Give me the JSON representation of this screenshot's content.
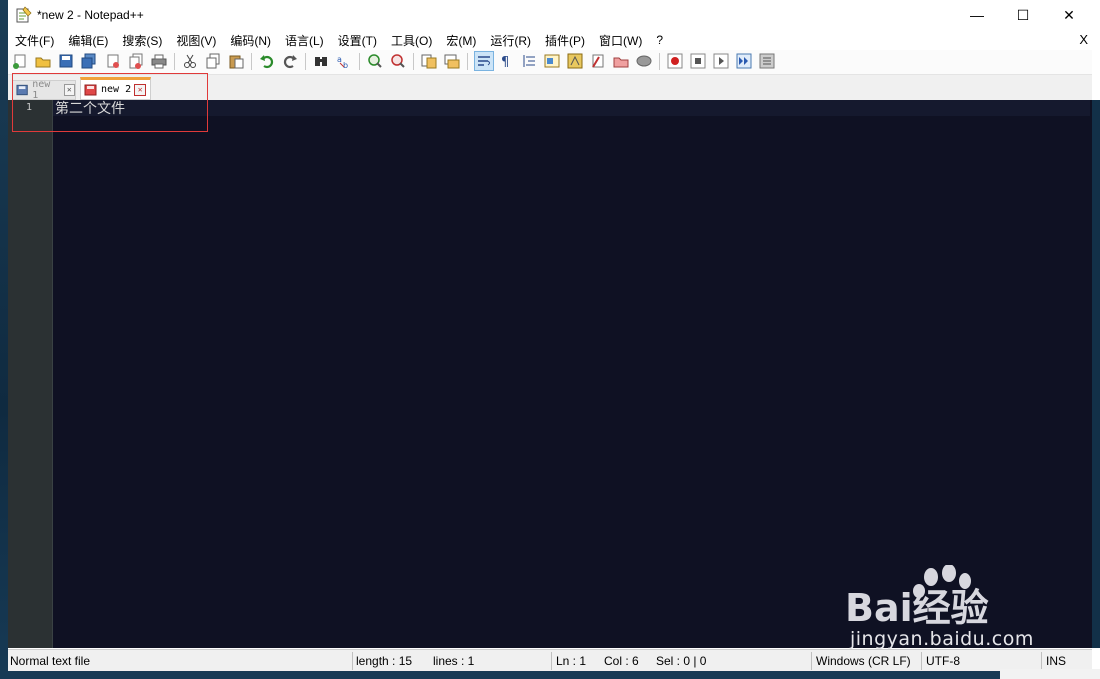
{
  "window": {
    "title": "*new 2 - Notepad++",
    "minimize_glyph": "—",
    "maximize_glyph": "☐",
    "close_glyph": "✕"
  },
  "menu": {
    "items": [
      "文件(F)",
      "编辑(E)",
      "搜索(S)",
      "视图(V)",
      "编码(N)",
      "语言(L)",
      "设置(T)",
      "工具(O)",
      "宏(M)",
      "运行(R)",
      "插件(P)",
      "窗口(W)",
      "?"
    ],
    "close_glyph": "X"
  },
  "toolbar": {
    "icons": [
      "new-file-icon",
      "open-file-icon",
      "save-icon",
      "save-all-icon",
      "close-icon",
      "close-all-icon",
      "print-icon",
      "cut-icon",
      "copy-icon",
      "paste-icon",
      "undo-icon",
      "redo-icon",
      "find-icon",
      "replace-icon",
      "zoom-in-icon",
      "zoom-out-icon",
      "sync-vertical-icon",
      "sync-horizontal-icon",
      "word-wrap-icon",
      "show-all-chars-icon",
      "indent-guide-icon",
      "doc-map-icon",
      "function-list-icon",
      "folder-as-workspace-icon",
      "monitoring-icon",
      "record-macro-icon",
      "stop-macro-icon",
      "play-macro-icon",
      "run-macro-multiple-icon",
      "save-macro-icon"
    ],
    "active_icon": "word-wrap-icon"
  },
  "tabs": [
    {
      "label": "new 1",
      "close_glyph": "✕",
      "active": false
    },
    {
      "label": "new 2",
      "close_glyph": "✕",
      "active": true
    }
  ],
  "editor": {
    "line_number": "1",
    "line_text": "第二个文件"
  },
  "status": {
    "file_type": "Normal text file",
    "length": "length : 15",
    "lines": "lines : 1",
    "ln": "Ln : 1",
    "col": "Col : 6",
    "sel": "Sel : 0 | 0",
    "eol": "Windows (CR LF)",
    "encoding": "UTF-8",
    "mode": "INS"
  },
  "watermark": {
    "brand_text": "Bai经验",
    "url": "jingyan.baidu.com"
  },
  "colors": {
    "editor_bg": "#0f1123",
    "gutter_bg": "#2b3133",
    "active_tab_accent": "#f0a23a",
    "highlight_border": "#e03a3a"
  }
}
